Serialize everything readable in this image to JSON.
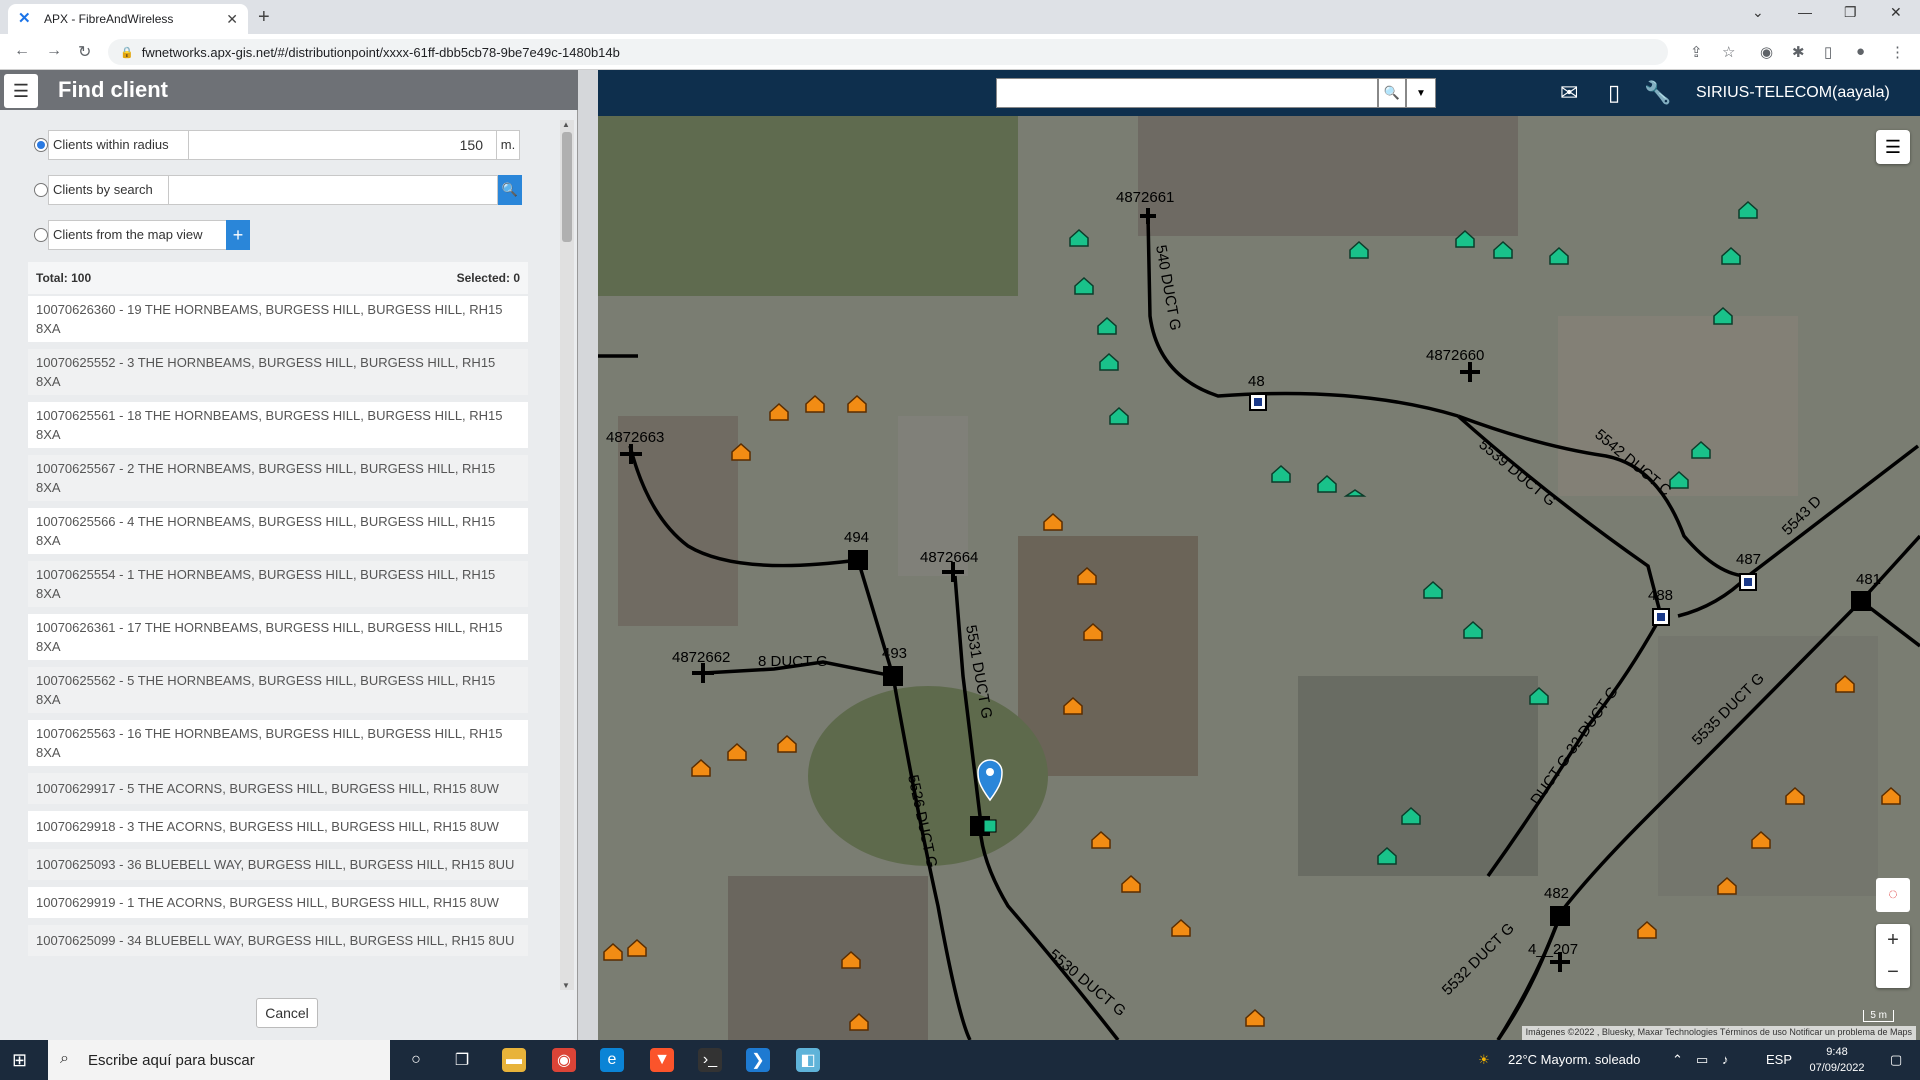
{
  "browser": {
    "tab_title": "APX - FibreAndWireless",
    "tab_close": "✕",
    "new_tab": "+",
    "url": "fwnetworks.apx-gis.net/#/distributionpoint/xxxx-61ff-dbb5cb78-9be7e49c-1480b14b"
  },
  "header": {
    "search_placeholder": "",
    "user": "SIRIUS-TELECOM(aayala)"
  },
  "panel": {
    "title": "Find client",
    "option_radius": "Clients within radius",
    "radius_value": "150",
    "radius_unit": "m.",
    "option_search": "Clients by search",
    "option_mapview": "Clients from the map view",
    "total_label": "Total: 100",
    "selected_label": "Selected: 0",
    "clients": [
      "10070626360 - 19 THE HORNBEAMS, BURGESS HILL, BURGESS HILL, RH15 8XA",
      "10070625552 - 3 THE HORNBEAMS, BURGESS HILL, BURGESS HILL, RH15 8XA",
      "10070625561 - 18 THE HORNBEAMS, BURGESS HILL, BURGESS HILL, RH15 8XA",
      "10070625567 - 2 THE HORNBEAMS, BURGESS HILL, BURGESS HILL, RH15 8XA",
      "10070625566 - 4 THE HORNBEAMS, BURGESS HILL, BURGESS HILL, RH15 8XA",
      "10070625554 - 1 THE HORNBEAMS, BURGESS HILL, BURGESS HILL, RH15 8XA",
      "10070626361 - 17 THE HORNBEAMS, BURGESS HILL, BURGESS HILL, RH15 8XA",
      "10070625562 - 5 THE HORNBEAMS, BURGESS HILL, BURGESS HILL, RH15 8XA",
      "10070625563 - 16 THE HORNBEAMS, BURGESS HILL, BURGESS HILL, RH15 8XA",
      "10070629917 - 5 THE ACORNS, BURGESS HILL, BURGESS HILL, RH15 8UW",
      "10070629918 - 3 THE ACORNS, BURGESS HILL, BURGESS HILL, RH15 8UW",
      "10070625093 - 36 BLUEBELL WAY, BURGESS HILL, BURGESS HILL, RH15 8UU",
      "10070629919 - 1 THE ACORNS, BURGESS HILL, BURGESS HILL, RH15 8UW",
      "10070625099 - 34 BLUEBELL WAY, BURGESS HILL, BURGESS HILL, RH15 8UU"
    ],
    "cancel": "Cancel"
  },
  "map": {
    "labels": {
      "n4872661": "4872661",
      "n4872660": "4872660",
      "n4872663": "4872663",
      "n4872664": "4872664",
      "n4872662": "4872662",
      "n48": "48",
      "n494": "494",
      "n493": "493",
      "n488": "488",
      "n487": "487",
      "n481": "481",
      "n482": "482",
      "n4_207": "4__207",
      "d540": "540 DUCT G",
      "d8": "8 DUCT G",
      "d5531": "5531 DUCT G",
      "d5526": "5526 DUCT G",
      "d5539": "5539 DUCT G",
      "d5542": "5542 DUCT C",
      "d5543": "5543 D",
      "d5535": "5535 DUCT G",
      "d5532": "5532 DUCT G",
      "d5530": "5530 DUCT G",
      "dG32": "DUCT G-32 DUCT G"
    },
    "attribution": "Imágenes ©2022 , Bluesky, Maxar Technologies   Términos de uso   Notificar un problema de Maps",
    "scale": "5 m"
  },
  "taskbar": {
    "search_placeholder": "Escribe aquí para buscar",
    "weather": "22°C  Mayorm. soleado",
    "lang": "ESP",
    "time": "9:48",
    "date": "07/09/2022"
  },
  "colors": {
    "header": "#0e2f4d",
    "client_marker_green": "#19c28a",
    "client_marker_orange": "#f28c14",
    "accent": "#2a86d9"
  }
}
